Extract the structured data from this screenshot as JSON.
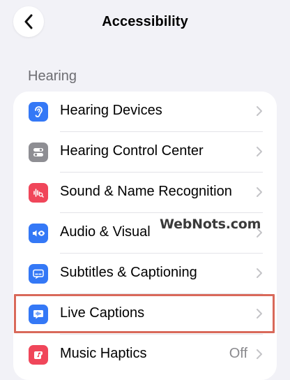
{
  "nav": {
    "title": "Accessibility",
    "back_icon": "chevron-left-icon"
  },
  "section": {
    "header": "Hearing"
  },
  "items": [
    {
      "label": "Hearing Devices",
      "icon": "ear-icon",
      "icon_color": "#3478f6",
      "value": ""
    },
    {
      "label": "Hearing Control Center",
      "icon": "toggles-icon",
      "icon_color": "#8e8e93",
      "value": ""
    },
    {
      "label": "Sound & Name Recognition",
      "icon": "waveform-search-icon",
      "icon_color": "#f0465a",
      "value": ""
    },
    {
      "label": "Audio & Visual",
      "icon": "speaker-eye-icon",
      "icon_color": "#3478f6",
      "value": ""
    },
    {
      "label": "Subtitles & Captioning",
      "icon": "subtitles-icon",
      "icon_color": "#3478f6",
      "value": ""
    },
    {
      "label": "Live Captions",
      "icon": "live-captions-icon",
      "icon_color": "#3478f6",
      "value": ""
    },
    {
      "label": "Music Haptics",
      "icon": "music-haptics-icon",
      "icon_color": "#f0465a",
      "value": "Off"
    }
  ],
  "watermark": "WebNots.com",
  "highlight_color": "#d9695a"
}
